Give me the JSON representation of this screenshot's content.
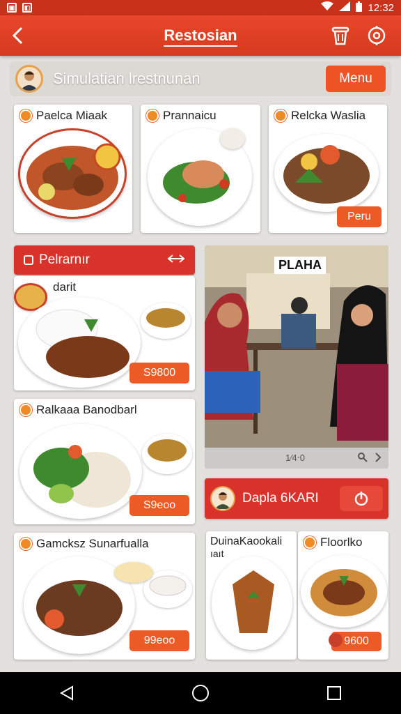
{
  "status_bar": {
    "left_icons": [
      "notification-icon",
      "app-icon"
    ],
    "right_icons": [
      "wifi-icon",
      "signal-icon",
      "battery-icon"
    ],
    "time": "12:32"
  },
  "app_bar": {
    "title": "Restosian",
    "icons": [
      "back-arrow-icon",
      "trash-icon",
      "settings-icon"
    ]
  },
  "subheader": {
    "title": "Simulatian lrestnunan",
    "menu_label": "Menu"
  },
  "top_cards": [
    {
      "title": "Paelca Miaak"
    },
    {
      "title": "Prannaicu"
    },
    {
      "title": "Relcka Waslia",
      "price": "Peru"
    }
  ],
  "left_section": {
    "header": "Pelrarnır",
    "cards": [
      {
        "title": "darit",
        "price": "S9800"
      },
      {
        "title": "Ralkaaa Banodbarl",
        "price": "S9eoo"
      },
      {
        "title": "Gamcksz Sunarfualla",
        "price": "99eoo"
      }
    ]
  },
  "photo_panel": {
    "sign": "PLAHA",
    "caption": "1⁄4⋅0"
  },
  "right_section": {
    "header": "Dapla 6KARI",
    "cards": [
      {
        "title": "DuinaKaookali",
        "subtitle": "ıaıt"
      },
      {
        "title": "Floorlko",
        "price": "9600"
      }
    ]
  },
  "colors": {
    "primary": "#e8472a",
    "accent": "#ec5a26",
    "header_red": "#d9322a",
    "background": "#e3e1dd"
  }
}
